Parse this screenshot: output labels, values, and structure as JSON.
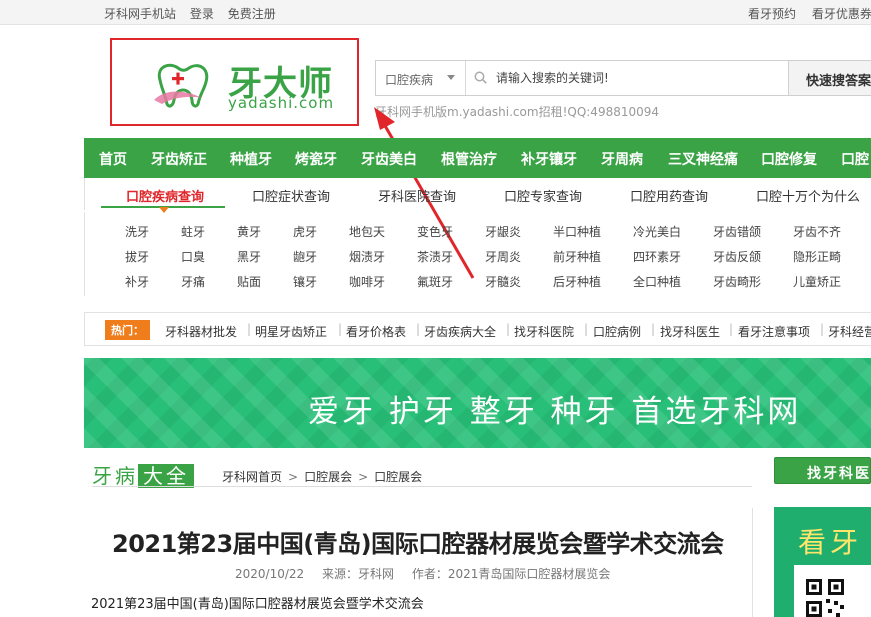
{
  "topbar": {
    "left": [
      "牙科网手机站",
      "登录",
      "免费注册"
    ],
    "right": [
      "看牙预约",
      "看牙优惠券"
    ]
  },
  "logo": {
    "cn": "牙大师",
    "en": "yadashi.com"
  },
  "search": {
    "category": "口腔疾病",
    "placeholder": "请输入搜索的关键词!",
    "button": "快速搜答案",
    "note": "牙科网手机版m.yadashi.com招租!QQ:498810094"
  },
  "nav": [
    "首页",
    "牙齿矫正",
    "种植牙",
    "烤瓷牙",
    "牙齿美白",
    "根管治疗",
    "补牙镶牙",
    "牙周病",
    "三叉神经痛",
    "口腔修复",
    "口腔"
  ],
  "subtabs": [
    "口腔疾病查询",
    "口腔症状查询",
    "牙科医院查询",
    "口腔专家查询",
    "口腔用药查询",
    "口腔十万个为什么"
  ],
  "keywords": [
    [
      "洗牙",
      "蛀牙",
      "黄牙",
      "虎牙",
      "地包天",
      "变色牙",
      "牙龈炎",
      "半口种植",
      "冷光美白",
      "牙齿错颌",
      "牙齿不齐"
    ],
    [
      "拔牙",
      "口臭",
      "黑牙",
      "龅牙",
      "烟渍牙",
      "茶渍牙",
      "牙周炎",
      "前牙种植",
      "四环素牙",
      "牙齿反颌",
      "隐形正畸"
    ],
    [
      "补牙",
      "牙痛",
      "贴面",
      "镶牙",
      "咖啡牙",
      "氟斑牙",
      "牙髓炎",
      "后牙种植",
      "全口种植",
      "牙齿畸形",
      "儿童矫正"
    ]
  ],
  "hot": {
    "label": "热门：",
    "items": [
      "牙科器材批发",
      "明星牙齿矫正",
      "看牙价格表",
      "牙齿疾病大全",
      "找牙科医院",
      "口腔病例",
      "找牙科医生",
      "看牙注意事项",
      "牙科经营"
    ]
  },
  "banner": {
    "text": "爱牙 护牙 整牙 种牙 首选牙科网"
  },
  "section": {
    "title_a": "牙病",
    "title_b": "大全",
    "crumbs": [
      "牙科网首页",
      "口腔展会",
      "口腔展会"
    ],
    "find_button": "找牙科医"
  },
  "article": {
    "title": "2021第23届中国(青岛)国际口腔器材展览会暨学术交流会",
    "date": "2020/10/22",
    "source": "来源：牙科网",
    "author": "作者：2021青岛国际口腔器材展览会",
    "body": "2021第23届中国(青岛)国际口腔器材展览会暨学术交流会"
  },
  "side_ad": {
    "text": "看牙"
  },
  "colors": {
    "brand_green": "#3aa346",
    "accent_red": "#e0262a",
    "hot_orange": "#f07d1b",
    "banner_green": "#28bf78"
  }
}
